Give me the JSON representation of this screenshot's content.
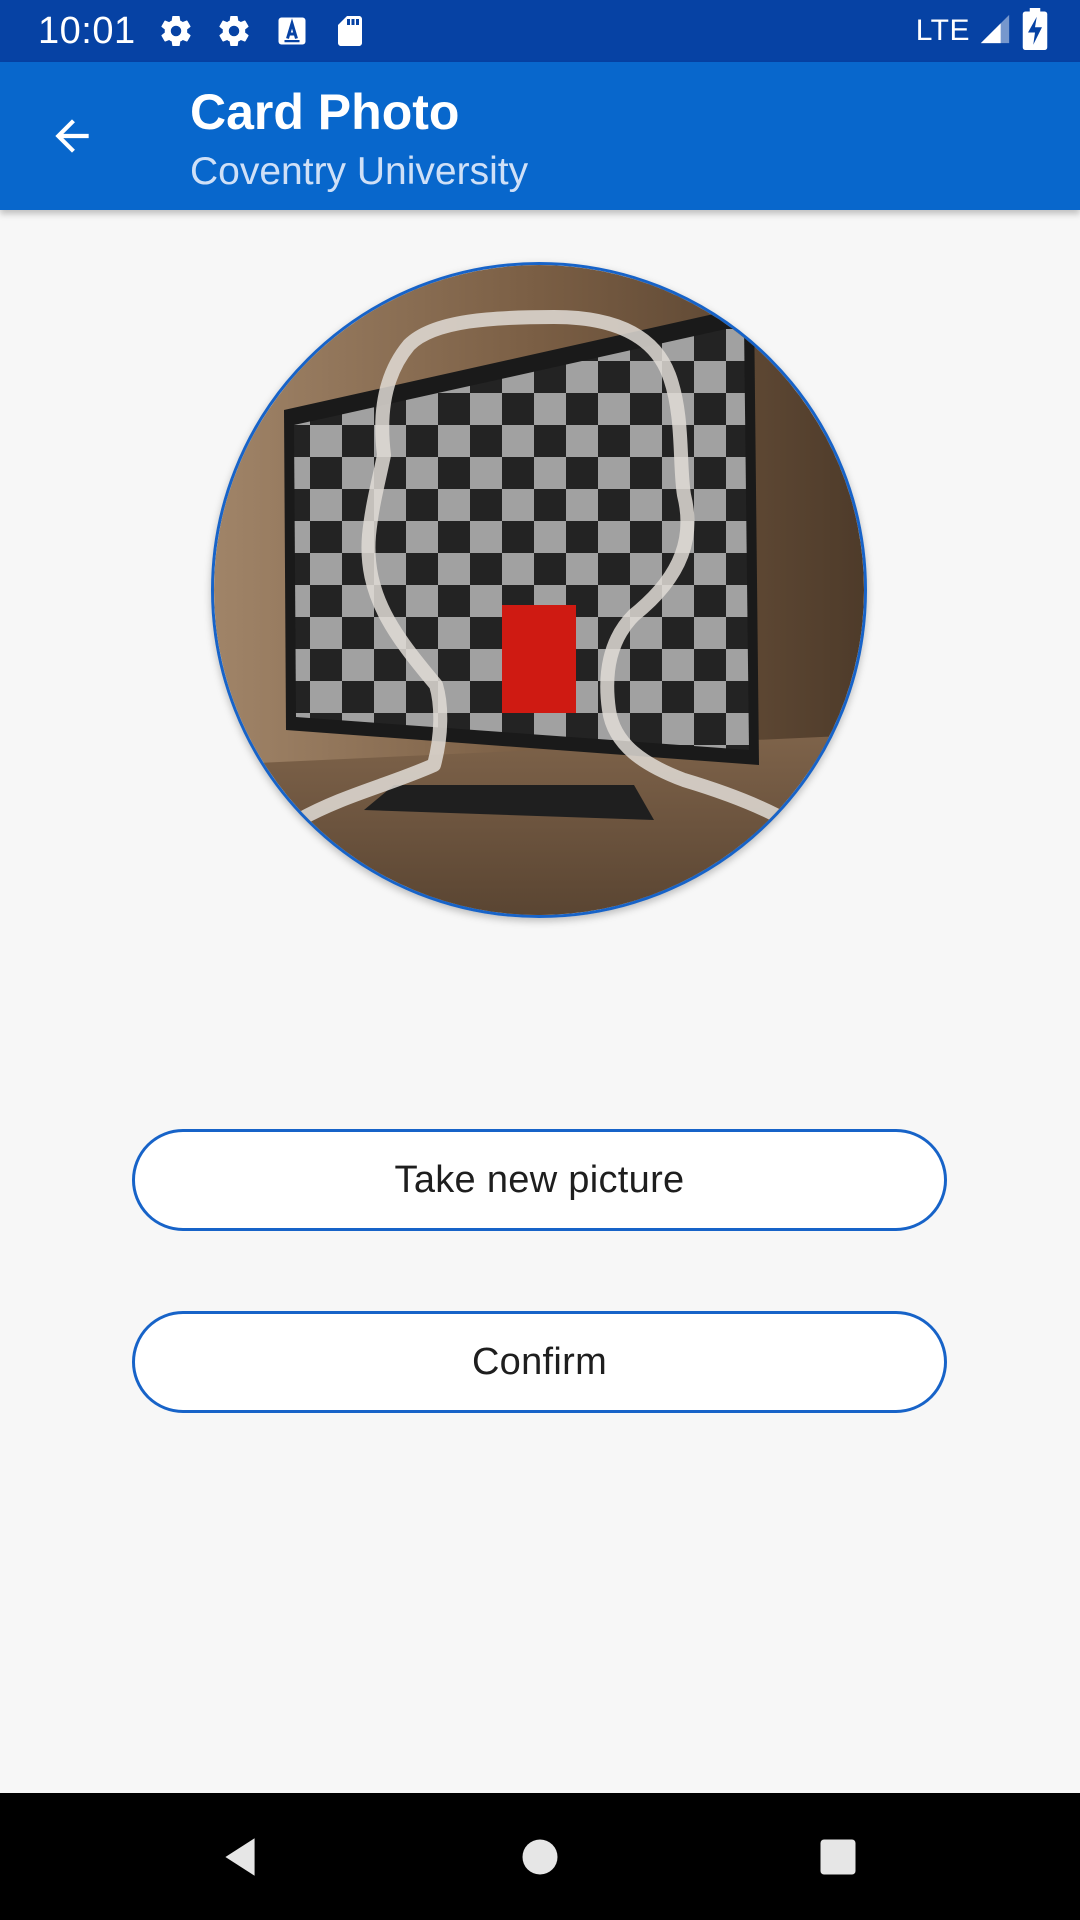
{
  "status_bar": {
    "time": "10:01",
    "network": "LTE",
    "icons": [
      "settings-icon",
      "settings-icon",
      "keyboard-a-icon",
      "sd-card-icon",
      "signal-icon",
      "battery-charging-icon"
    ]
  },
  "app_bar": {
    "title": "Card Photo",
    "subtitle": "Coventry University",
    "back_icon": "arrow-back-icon"
  },
  "photo": {
    "description_icon": "face-outline-guide-icon"
  },
  "actions": {
    "take_new_picture": "Take new picture",
    "confirm": "Confirm"
  },
  "nav_bar": {
    "icons": [
      "nav-back-icon",
      "nav-home-icon",
      "nav-recents-icon"
    ]
  },
  "colors": {
    "status_bar": "#0642a4",
    "app_bar": "#0867cc",
    "accent": "#1763c8",
    "background": "#f7f7f7"
  }
}
